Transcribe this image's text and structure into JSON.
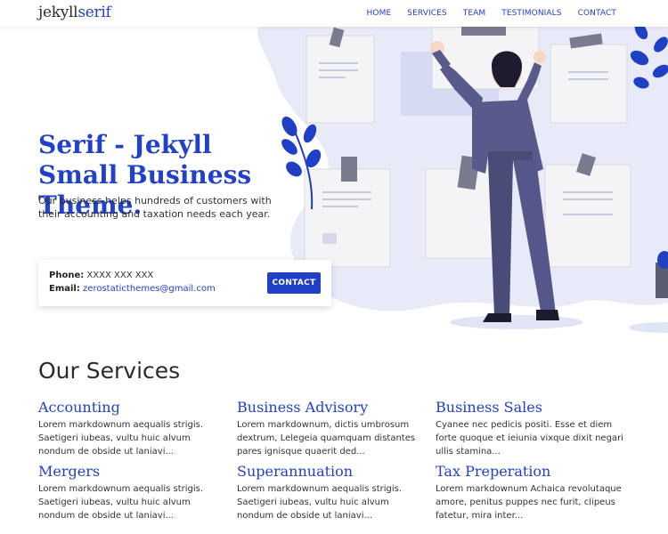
{
  "header": {
    "logo_part1": "jekyll",
    "logo_part2": "serif",
    "nav": [
      "HOME",
      "SERVICES",
      "TEAM",
      "TESTIMONIALS",
      "CONTACT"
    ]
  },
  "hero": {
    "title": "Serif - Jekyll Small Business Theme.",
    "lead": "Our business helps hundreds of customers with their accounting and taxation needs each year.",
    "phone_label": "Phone:",
    "phone_value": "XXXX XXX XXX",
    "email_label": "Email:",
    "email_value": "zerostaticthemes@gmail.com",
    "contact_button": "CONTACT"
  },
  "services": {
    "title": "Our Services",
    "items": [
      {
        "name": "Accounting",
        "desc": "Lorem markdownum aequalis strigis. Saetigeri iubeas, vultu huic alvum nondum de obside ut laniavi..."
      },
      {
        "name": "Business Advisory",
        "desc": "Lorem markdownum, dictis umbrosum dextrum, Lelegeia quamquam distantes pares ignisque quaerit ded..."
      },
      {
        "name": "Business Sales",
        "desc": "Cyanee nec pedicis positi. Esse et diem forte quoque et ieiunia vixque dixit negari ullis stamina..."
      },
      {
        "name": "Mergers",
        "desc": "Lorem markdownum aequalis strigis. Saetigeri iubeas, vultu huic alvum nondum de obside ut laniavi..."
      },
      {
        "name": "Superannuation",
        "desc": "Lorem markdownum aequalis strigis. Saetigeri iubeas, vultu huic alvum nondum de obside ut laniavi..."
      },
      {
        "name": "Tax Preperation",
        "desc": "Lorem markdownum Achaica revolutaque amore, penitus puppes nec furit, clipeus fatetur, mira inter..."
      }
    ]
  },
  "colors": {
    "accent": "#2141c8",
    "blob": "#e8eaf8",
    "figure": "#575a8a"
  }
}
